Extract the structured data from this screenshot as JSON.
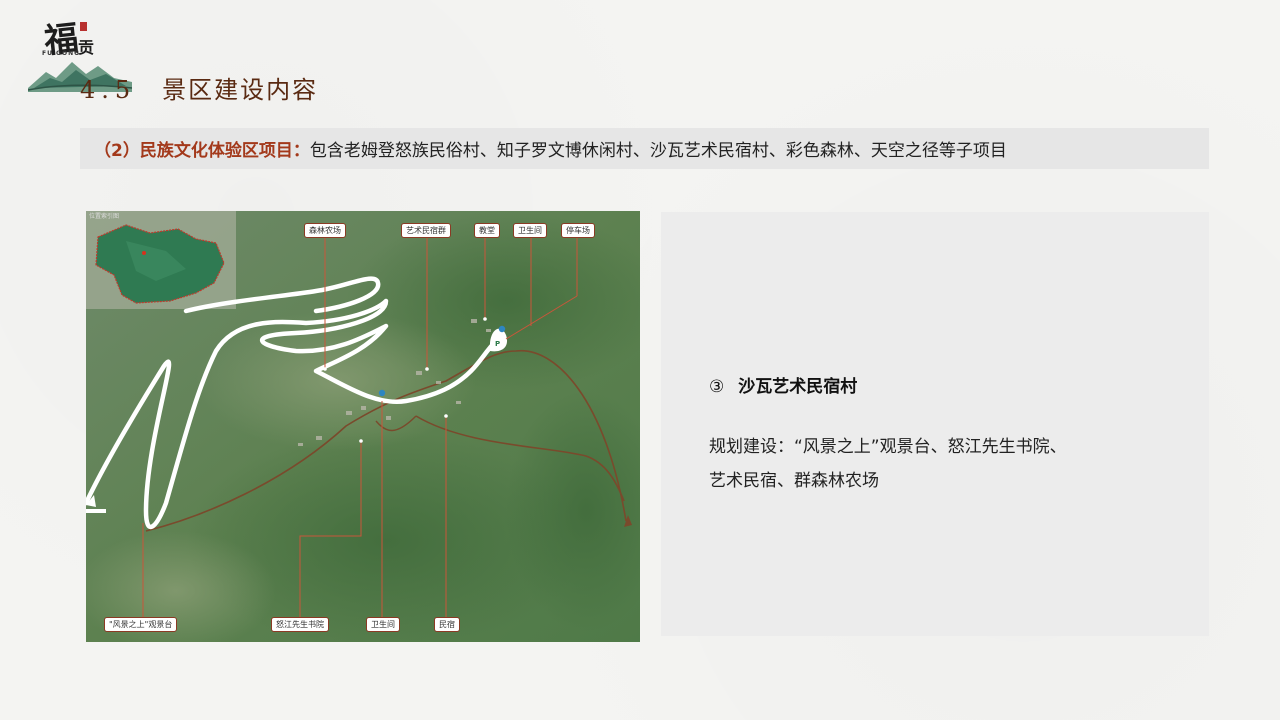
{
  "logo": {
    "char_main": "福",
    "char_small": "贡",
    "subtitle": "FU GONG"
  },
  "section": {
    "number": "4.5",
    "title": "景区建设内容"
  },
  "banner": {
    "label": "（2）民族文化体验区项目：",
    "text": "包含老姆登怒族民俗村、知子罗文博休闲村、沙瓦艺术民宿村、彩色森林、天空之径等子项目"
  },
  "map": {
    "inset_title": "位置索引图",
    "road_note": "",
    "labels": {
      "forest_farm": "森林农场",
      "art_homestay": "艺术民宿群",
      "church": "教堂",
      "toilet_top": "卫生间",
      "parking": "停车场",
      "viewpoint": "\"风景之上\"观景台",
      "nujiang_academy": "怒江先生书院",
      "toilet_bottom": "卫生间",
      "homestay": "民宿"
    }
  },
  "panel": {
    "number": "③",
    "heading": "沙瓦艺术民宿村",
    "line1": "规划建设：“风景之上”观景台、怒江先生书院、",
    "line2": "艺术民宿、群森林农场"
  },
  "colors": {
    "title_brown": "#5a2a12",
    "banner_red": "#a3391b",
    "map_route_brown": "#7a4a2c",
    "map_leader_red": "#c9563a"
  }
}
